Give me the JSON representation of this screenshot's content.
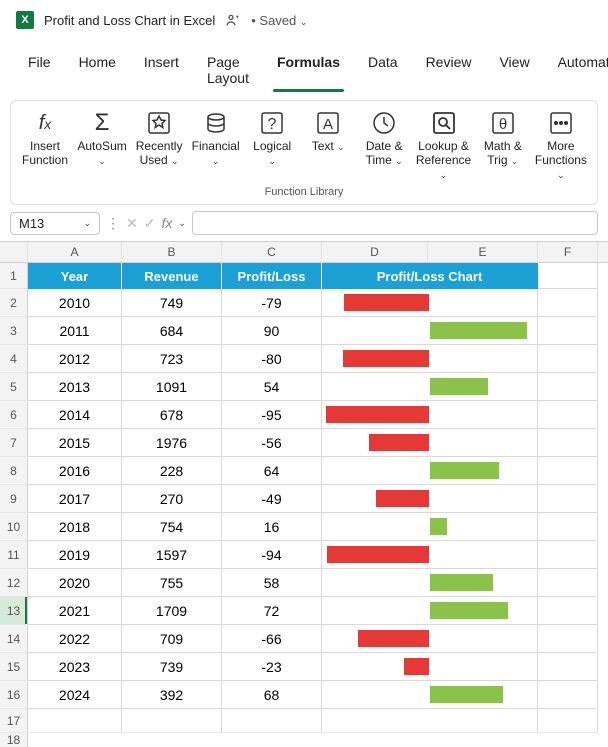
{
  "titlebar": {
    "filename": "Profit and Loss Chart in Excel",
    "saved": "• Saved"
  },
  "tabs": [
    "File",
    "Home",
    "Insert",
    "Page Layout",
    "Formulas",
    "Data",
    "Review",
    "View",
    "Automate"
  ],
  "active_tab": 4,
  "ribbon": {
    "buttons": [
      {
        "label": "Insert\nFunction",
        "icon": "fx",
        "dd": false
      },
      {
        "label": "AutoSum",
        "icon": "sigma",
        "dd": true
      },
      {
        "label": "Recently\nUsed",
        "icon": "star",
        "dd": true
      },
      {
        "label": "Financial",
        "icon": "db",
        "dd": true
      },
      {
        "label": "Logical",
        "icon": "question",
        "dd": true
      },
      {
        "label": "Text",
        "icon": "A",
        "dd": true
      },
      {
        "label": "Date &\nTime",
        "icon": "clock",
        "dd": true
      },
      {
        "label": "Lookup &\nReference",
        "icon": "search",
        "dd": true
      },
      {
        "label": "Math &\nTrig",
        "icon": "theta",
        "dd": true
      },
      {
        "label": "More\nFunctions",
        "icon": "dots",
        "dd": true
      }
    ],
    "group_caption": "Function Library"
  },
  "namebox": {
    "cell": "M13",
    "fx_label": "fx"
  },
  "columns": [
    "A",
    "B",
    "C",
    "D",
    "E",
    "F"
  ],
  "headers": {
    "year": "Year",
    "revenue": "Revenue",
    "pl": "Profit/Loss",
    "chart": "Profit/Loss Chart"
  },
  "selected_row_index": 12,
  "chart_data": {
    "type": "bar",
    "title": "Profit/Loss Chart",
    "xlabel": "Year",
    "ylabel": "Profit/Loss",
    "categories": [
      2010,
      2011,
      2012,
      2013,
      2014,
      2015,
      2016,
      2017,
      2018,
      2019,
      2020,
      2021,
      2022,
      2023,
      2024
    ],
    "series": [
      {
        "name": "Revenue",
        "values": [
          749,
          684,
          723,
          1091,
          678,
          1976,
          228,
          270,
          754,
          1597,
          755,
          1709,
          709,
          739,
          392
        ]
      },
      {
        "name": "Profit/Loss",
        "values": [
          -79,
          90,
          -80,
          54,
          -95,
          -56,
          64,
          -49,
          16,
          -94,
          58,
          72,
          -66,
          -23,
          68
        ]
      }
    ],
    "colors": {
      "positive": "#8bc34a",
      "negative": "#e53935"
    },
    "ylim": [
      -100,
      100
    ]
  },
  "rows": [
    {
      "year": 2010,
      "revenue": 749,
      "pl": -79
    },
    {
      "year": 2011,
      "revenue": 684,
      "pl": 90
    },
    {
      "year": 2012,
      "revenue": 723,
      "pl": -80
    },
    {
      "year": 2013,
      "revenue": 1091,
      "pl": 54
    },
    {
      "year": 2014,
      "revenue": 678,
      "pl": -95
    },
    {
      "year": 2015,
      "revenue": 1976,
      "pl": -56
    },
    {
      "year": 2016,
      "revenue": 228,
      "pl": 64
    },
    {
      "year": 2017,
      "revenue": 270,
      "pl": -49
    },
    {
      "year": 2018,
      "revenue": 754,
      "pl": 16
    },
    {
      "year": 2019,
      "revenue": 1597,
      "pl": -94
    },
    {
      "year": 2020,
      "revenue": 755,
      "pl": 58
    },
    {
      "year": 2021,
      "revenue": 1709,
      "pl": 72
    },
    {
      "year": 2022,
      "revenue": 709,
      "pl": -66
    },
    {
      "year": 2023,
      "revenue": 739,
      "pl": -23
    },
    {
      "year": 2024,
      "revenue": 392,
      "pl": 68
    }
  ]
}
